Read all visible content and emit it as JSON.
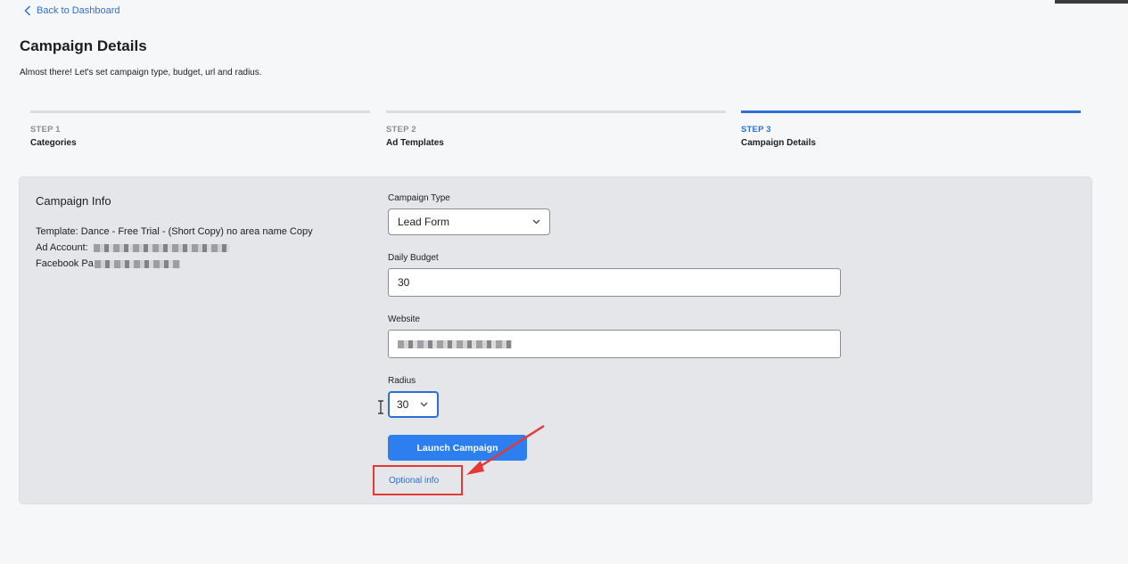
{
  "nav": {
    "back_label": "Back to Dashboard"
  },
  "header": {
    "title": "Campaign Details",
    "subtitle": "Almost there! Let's set campaign type, budget, url and radius."
  },
  "steps": [
    {
      "num": "STEP 1",
      "label": "Categories",
      "active": false
    },
    {
      "num": "STEP 2",
      "label": "Ad Templates",
      "active": false
    },
    {
      "num": "STEP 3",
      "label": "Campaign Details",
      "active": true
    }
  ],
  "campaign_info": {
    "title": "Campaign Info",
    "template_key": "Template:",
    "template_value": "Dance - Free Trial - (Short Copy) no area name Copy",
    "ad_account_key": "Ad Account:",
    "facebook_page_key": "Facebook Pa"
  },
  "form": {
    "campaign_type_label": "Campaign Type",
    "campaign_type_value": "Lead Form",
    "daily_budget_label": "Daily Budget",
    "daily_budget_value": "30",
    "website_label": "Website",
    "radius_label": "Radius",
    "radius_value": "30",
    "launch_label": "Launch Campaign",
    "optional_label": "Optional info"
  },
  "colors": {
    "accent": "#2d6fd6",
    "button": "#2d7ff0",
    "annotation": "#e53935",
    "card_bg": "#e4e6ea"
  },
  "icons": {
    "back": "chevron-left-icon",
    "dropdown": "chevron-down-icon",
    "annotation_arrow": "red-arrow-icon"
  }
}
